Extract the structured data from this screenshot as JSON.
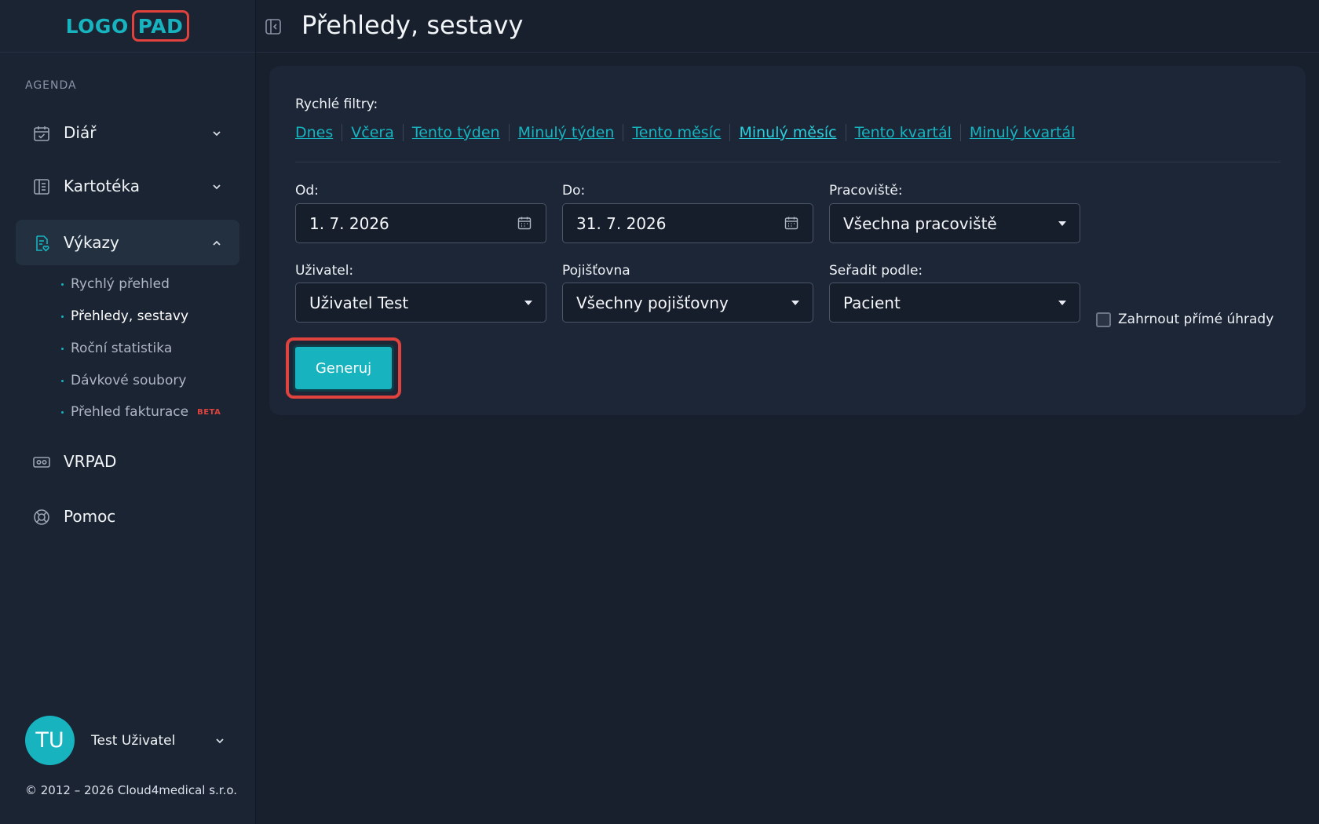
{
  "logo": {
    "part1": "LOGO",
    "part2": "PAD"
  },
  "sidebar": {
    "section": "AGENDA",
    "items": [
      {
        "label": "Diář",
        "icon": "calendar-check-icon"
      },
      {
        "label": "Kartotéka",
        "icon": "card-file-icon"
      },
      {
        "label": "Výkazy",
        "icon": "report-icon"
      },
      {
        "label": "VRPAD",
        "icon": "vr-headset-icon"
      },
      {
        "label": "Pomoc",
        "icon": "lifebuoy-icon"
      }
    ],
    "subitems": [
      {
        "label": "Rychlý přehled"
      },
      {
        "label": "Přehledy, sestavy"
      },
      {
        "label": "Roční statistika"
      },
      {
        "label": "Dávkové soubory"
      },
      {
        "label": "Přehled fakturace",
        "badge": "BETA"
      }
    ],
    "user": {
      "initials": "TU",
      "name": "Test Uživatel"
    },
    "copyright": "© 2012 – 2026 Cloud4medical s.r.o."
  },
  "header": {
    "title": "Přehledy, sestavy"
  },
  "filters": {
    "quick_label": "Rychlé filtry:",
    "quick": [
      "Dnes",
      "Včera",
      "Tento týden",
      "Minulý týden",
      "Tento měsíc",
      "Minulý měsíc",
      "Tento kvartál",
      "Minulý kvartál"
    ],
    "from": {
      "label": "Od:",
      "value": "1. 7. 2026"
    },
    "to": {
      "label": "Do:",
      "value": "31. 7. 2026"
    },
    "workplace": {
      "label": "Pracoviště:",
      "value": "Všechna pracoviště"
    },
    "user": {
      "label": "Uživatel:",
      "value": "Uživatel Test"
    },
    "insurer": {
      "label": "Pojišťovna",
      "value": "Všechny pojišťovny"
    },
    "sort": {
      "label": "Seřadit podle:",
      "value": "Pacient"
    },
    "direct_payments": {
      "label": "Zahrnout přímé úhrady",
      "checked": false
    },
    "generate_label": "Generuj"
  },
  "colors": {
    "accent": "#17b4c0",
    "highlight": "#e0423d",
    "background": "#18202e"
  }
}
